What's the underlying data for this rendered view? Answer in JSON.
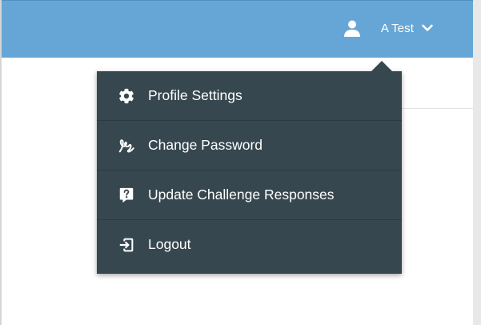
{
  "header": {
    "user_name": "A Test",
    "user_icon": "person-icon",
    "menu_toggle_icon": "chevron-down-icon",
    "bar_color": "#66a6d6"
  },
  "user_menu": {
    "background_color": "#37474f",
    "items": [
      {
        "label": "Profile Settings",
        "icon": "gear-icon"
      },
      {
        "label": "Change Password",
        "icon": "signature-icon"
      },
      {
        "label": "Update Challenge Responses",
        "icon": "question-mark-icon"
      },
      {
        "label": "Logout",
        "icon": "logout-icon"
      }
    ]
  }
}
